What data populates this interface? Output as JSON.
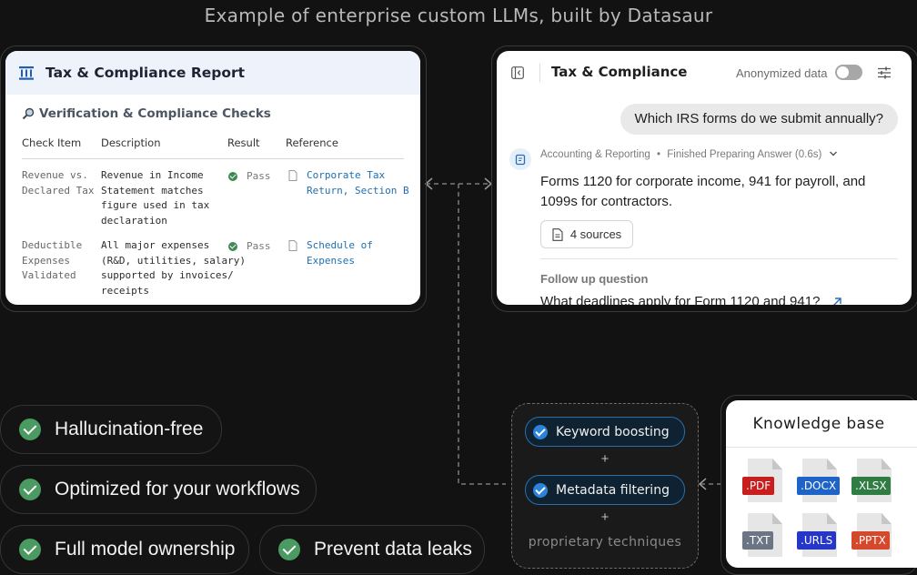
{
  "headline": "Example of enterprise custom LLMs, built by Datasaur",
  "report": {
    "title": "Tax & Compliance Report",
    "section_title": "Verification & Compliance Checks",
    "columns": [
      "Check Item",
      "Description",
      "Result",
      "Reference"
    ],
    "rows": [
      {
        "item": [
          "Revenue vs.",
          "Declared Tax"
        ],
        "description": [
          "Revenue in Income",
          "Statement matches",
          "figure used in tax",
          "declaration"
        ],
        "result": "Pass",
        "reference": [
          "Corporate Tax",
          "Return, Section B"
        ]
      },
      {
        "item": [
          "Deductible",
          "Expenses",
          "Validated"
        ],
        "description": [
          "All major expenses",
          "(R&D, utilities, salary)",
          "supported by invoices/",
          "receipts"
        ],
        "result": "Pass",
        "reference": [
          "Schedule of",
          "Expenses"
        ]
      }
    ]
  },
  "chat": {
    "title": "Tax & Compliance",
    "anonymized_label": "Anonymized data",
    "anonymized_on": false,
    "user_message": "Which IRS forms do we submit annually?",
    "bot_category": "Accounting & Reporting",
    "bot_status": "Finished Preparing Answer",
    "bot_time": "(0.6s)",
    "answer_lines": [
      "Forms 1120 for corporate income, 941 for payroll, and",
      "1099s for contractors."
    ],
    "sources_label": "4 sources",
    "follow_up_label": "Follow up question",
    "follow_up_question": "What deadlines apply for Form 1120 and 941?"
  },
  "features": [
    "Hallucination-free",
    "Optimized for your workflows",
    "Full model ownership",
    "Prevent data leaks"
  ],
  "techniques": {
    "items": [
      "Keyword boosting",
      "Metadata filtering"
    ],
    "plus": "+",
    "footer": "proprietary techniques"
  },
  "knowledge_base": {
    "title": "Knowledge base",
    "files": [
      {
        "label": ".PDF",
        "color": "#c81e1e"
      },
      {
        "label": ".DOCX",
        "color": "#1e63c8"
      },
      {
        "label": ".XLSX",
        "color": "#2f7d43"
      },
      {
        "label": ".TXT",
        "color": "#6b7583"
      },
      {
        "label": ".URLS",
        "color": "#2536c9"
      },
      {
        "label": ".PPTX",
        "color": "#d6482b"
      }
    ]
  },
  "colors": {
    "background": "#121212",
    "check_green": "#4a9a62",
    "chip_blue": "#2a83d9",
    "link_blue": "#1f6fb0"
  }
}
